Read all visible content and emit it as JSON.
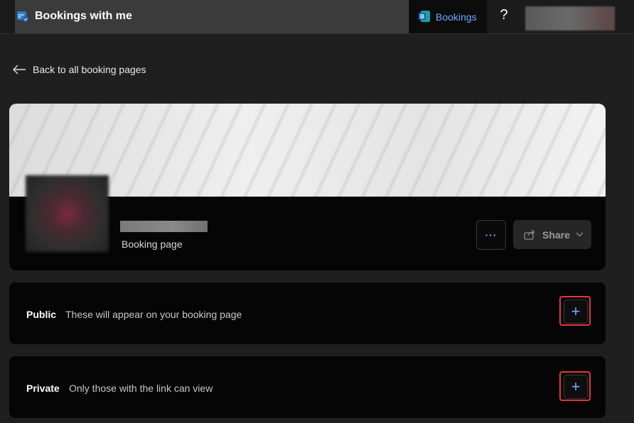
{
  "app": {
    "title": "Bookings with me",
    "bookings_tab_label": "Bookings",
    "help_label": "?"
  },
  "nav": {
    "back_label": "Back to all booking pages"
  },
  "page": {
    "subtitle": "Booking page",
    "share_label": "Share",
    "more_label": "···"
  },
  "sections": [
    {
      "title": "Public",
      "description": "These will appear on your booking page",
      "add_label": "+"
    },
    {
      "title": "Private",
      "description": "Only those with the link can view",
      "add_label": "+"
    }
  ],
  "colors": {
    "accent": "#6ea8ff",
    "highlight_border": "#e0383e",
    "background": "#1f1f1f",
    "card": "#050505"
  }
}
